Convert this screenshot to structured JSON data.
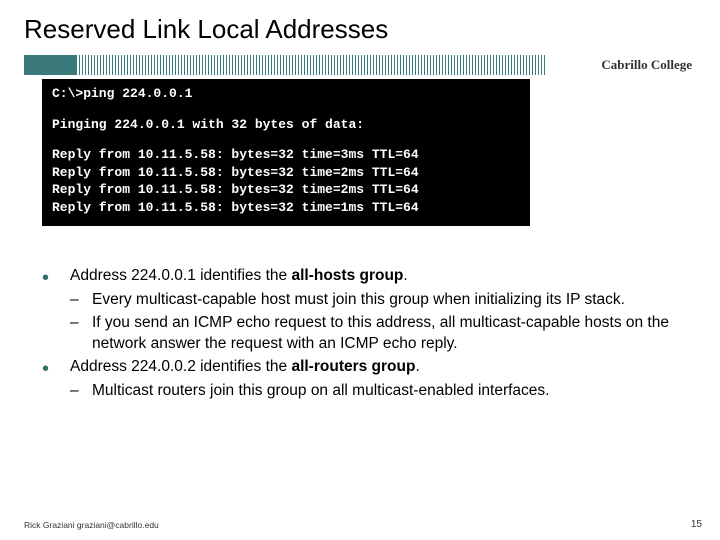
{
  "title": "Reserved Link Local Addresses",
  "college": "Cabrillo College",
  "terminal": {
    "cmd": "C:\\>ping 224.0.0.1",
    "header": "Pinging 224.0.0.1 with 32 bytes of data:",
    "replies": [
      "Reply from 10.11.5.58: bytes=32 time=3ms TTL=64",
      "Reply from 10.11.5.58: bytes=32 time=2ms TTL=64",
      "Reply from 10.11.5.58: bytes=32 time=2ms TTL=64",
      "Reply from 10.11.5.58: bytes=32 time=1ms TTL=64"
    ]
  },
  "bullets": [
    {
      "pre": "Address 224.0.0.1 identifies the ",
      "bold": "all-hosts group",
      "post": ".",
      "subs": [
        "Every multicast-capable host must join this group when initializing its IP stack.",
        "If you send an ICMP echo request to this address, all multicast-capable hosts on the network answer the request with an ICMP echo reply."
      ]
    },
    {
      "pre": "Address 224.0.0.2 identifies the ",
      "bold": "all-routers group",
      "post": ".",
      "subs": [
        "Multicast routers join this group on all multicast-enabled interfaces."
      ]
    }
  ],
  "footer": "Rick Graziani  graziani@cabrillo.edu",
  "page": "15"
}
